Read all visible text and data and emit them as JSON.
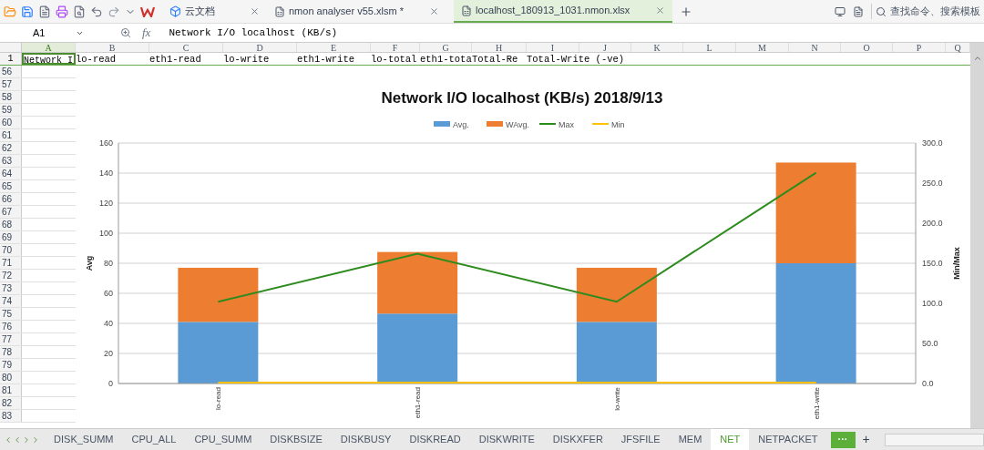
{
  "title_bar": {
    "cloud_docs": "云文档",
    "tabs": [
      {
        "title": "nmon analyser v55.xlsm *",
        "selected": false
      },
      {
        "title": "localhost_180913_1031.nmon.xlsx",
        "selected": true
      }
    ],
    "search": {
      "placeholder": "查找命令、搜索模板"
    }
  },
  "formula_bar": {
    "cell_ref": "A1",
    "fx": "fx",
    "value": "Network I/O localhost (KB/s)"
  },
  "columns": [
    "A",
    "B",
    "C",
    "D",
    "E",
    "F",
    "G",
    "H",
    "I",
    "J",
    "K",
    "L",
    "M",
    "N",
    "O",
    "P",
    "Q"
  ],
  "row_1": {
    "number": "1",
    "cells": [
      "Network I",
      "lo-read",
      "eth1-read",
      "lo-write",
      "eth1-write",
      "lo-total",
      "eth1-tota",
      "Total-Re",
      "Total-Write (-ve)"
    ]
  },
  "rows": [
    "56",
    "57",
    "58",
    "59",
    "60",
    "61",
    "62",
    "63",
    "64",
    "65",
    "66",
    "67",
    "68",
    "69",
    "70",
    "71",
    "72",
    "73",
    "74",
    "75",
    "76",
    "77",
    "78",
    "79",
    "80",
    "81",
    "82",
    "83"
  ],
  "chart": {
    "chart_data": {
      "type": "bar",
      "title": "Network I/O localhost (KB/s)  2018/9/13",
      "stacked": true,
      "ylabel": "Avg",
      "y2label": "Min/Max",
      "categories": [
        "lo-read",
        "eth1-read",
        "lo-write",
        "eth1-write"
      ],
      "series": [
        {
          "name": "Avg.",
          "color": "#5b9bd5",
          "values": [
            41,
            46.5,
            41,
            80
          ]
        },
        {
          "name": "WAvg.",
          "color": "#ed7d31",
          "values": [
            36,
            41,
            36,
            67
          ]
        },
        {
          "name": "Max",
          "color": "#2e8b1e",
          "values": [
            102,
            162,
            102,
            263
          ],
          "axis": "y2",
          "type": "line"
        },
        {
          "name": "Min",
          "color": "#ffc000",
          "values": [
            0,
            0,
            0,
            0
          ],
          "axis": "y2",
          "type": "line"
        }
      ],
      "grid": true,
      "legend": true,
      "ylim": [
        0,
        160
      ],
      "yticks": [
        0,
        20,
        40,
        60,
        80,
        100,
        120,
        140,
        160
      ],
      "y2lim": [
        0,
        300
      ],
      "y2ticks": [
        {
          "value": 0,
          "label": "0.0"
        },
        {
          "value": 50,
          "label": "50.0"
        },
        {
          "value": 100,
          "label": "100.0"
        },
        {
          "value": 150,
          "label": "150.0"
        },
        {
          "value": 200,
          "label": "200.0"
        },
        {
          "value": 250,
          "label": "250.0"
        },
        {
          "value": 300,
          "label": "300.0"
        }
      ]
    }
  },
  "sheet_tabs": [
    {
      "label": "DISK_SUMM",
      "selected": false
    },
    {
      "label": "CPU_ALL",
      "selected": false
    },
    {
      "label": "CPU_SUMM",
      "selected": false
    },
    {
      "label": "DISKBSIZE",
      "selected": false
    },
    {
      "label": "DISKBUSY",
      "selected": false
    },
    {
      "label": "DISKREAD",
      "selected": false
    },
    {
      "label": "DISKWRITE",
      "selected": false
    },
    {
      "label": "DISKXFER",
      "selected": false
    },
    {
      "label": "JFSFILE",
      "selected": false
    },
    {
      "label": "MEM",
      "selected": false
    },
    {
      "label": "NET",
      "selected": true
    },
    {
      "label": "NETPACKET",
      "selected": false
    }
  ],
  "more_tabs": "···",
  "add_sheet": "+"
}
